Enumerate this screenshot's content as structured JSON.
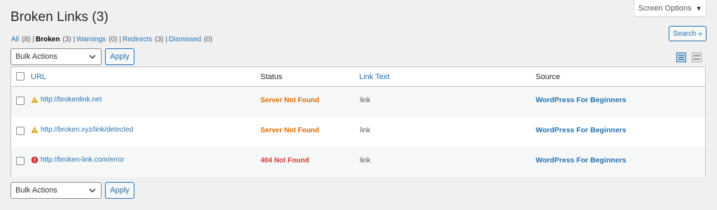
{
  "header": {
    "title": "Broken Links (3)",
    "screen_options": "Screen Options",
    "search_button": "Search »"
  },
  "filters": [
    {
      "label": "All",
      "count": "(8)",
      "current": false
    },
    {
      "label": "Broken",
      "count": "(3)",
      "current": true
    },
    {
      "label": "Warnings",
      "count": "(0)",
      "current": false
    },
    {
      "label": "Redirects",
      "count": "(3)",
      "current": false
    },
    {
      "label": "Dismissed",
      "count": "(0)",
      "current": false
    }
  ],
  "bulk_actions": {
    "selected": "Bulk Actions",
    "apply_label": "Apply"
  },
  "table": {
    "headers": {
      "url": "URL",
      "status": "Status",
      "link_text": "Link Text",
      "source": "Source"
    },
    "rows": [
      {
        "url": "http://brokenlink.net",
        "icon": "warning-icon",
        "status": "Server Not Found",
        "status_color": "#dd6b00",
        "link_text": "link",
        "source": "WordPress For Beginners"
      },
      {
        "url": "http://broken.xyz/link/detected",
        "icon": "warning-icon",
        "status": "Server Not Found",
        "status_color": "#dd6b00",
        "link_text": "link",
        "source": "WordPress For Beginners"
      },
      {
        "url": "http://broken-link.com/error",
        "icon": "error-icon",
        "status": "404 Not Found",
        "status_color": "#d63638",
        "link_text": "link",
        "source": "WordPress For Beginners"
      }
    ]
  },
  "colors": {
    "accent": "#2271b1",
    "warning": "#dd6b00",
    "error": "#d63638",
    "warning_icon": "#dba617",
    "background": "#f0f0f1"
  }
}
